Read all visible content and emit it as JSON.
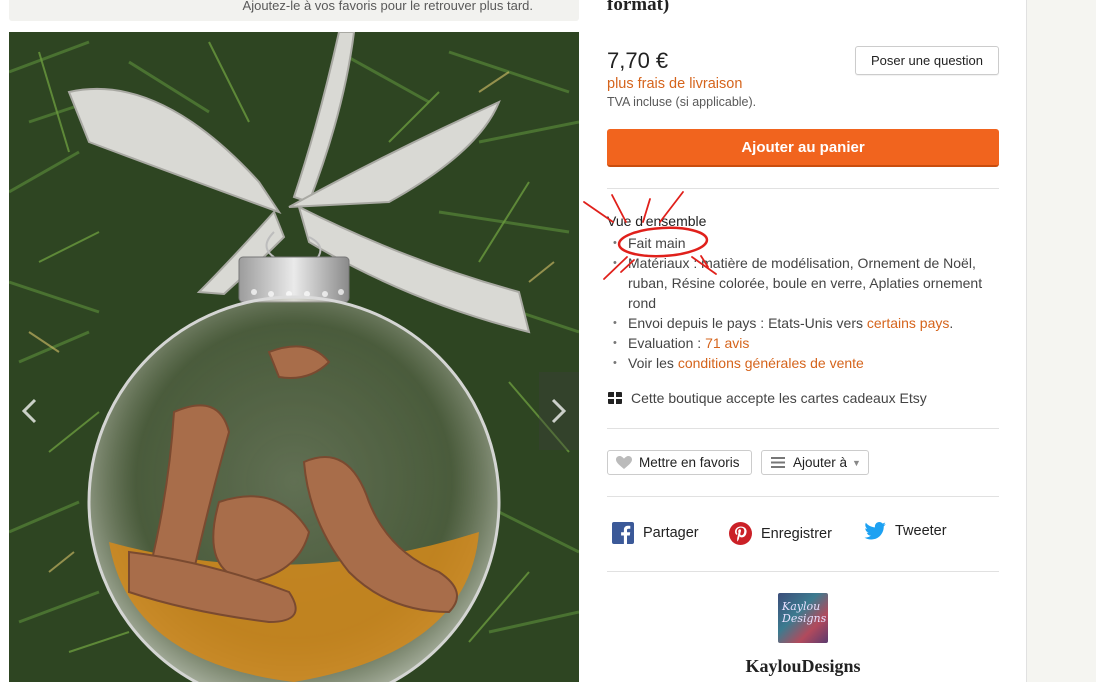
{
  "favorites_banner": {
    "text": "Ajoutez-le à vos favoris pour le retrouver plus tard."
  },
  "product": {
    "title_fragment": "format)",
    "price": "7,70 €",
    "shipping": "plus frais de livraison",
    "tva": "TVA incluse (si applicable).",
    "ask_question": "Poser une question",
    "add_to_cart": "Ajouter au panier"
  },
  "overview": {
    "title": "Vue d'ensemble",
    "handmade": "Fait main",
    "materials": "Matériaux : matière de modélisation, Ornement de Noël, ruban, Résine colorée, boule en verre, Aplaties ornement rond",
    "ships_from_prefix": "Envoi depuis le pays : Etats-Unis vers ",
    "ships_from_link": "certains pays",
    "ships_from_suffix": ".",
    "rating_prefix": "Evaluation : ",
    "rating_link": "71 avis",
    "terms_prefix": "Voir les ",
    "terms_link": "conditions générales de vente"
  },
  "giftcard": {
    "text": "Cette boutique accepte les cartes cadeaux Etsy",
    "icon": "gift-card-icon"
  },
  "actions": {
    "favorite": "Mettre en favoris",
    "add_to": "Ajouter à"
  },
  "share": {
    "facebook": "Partager",
    "pinterest": "Enregistrer",
    "twitter": "Tweeter"
  },
  "shop": {
    "avatar_text": "Kaylou Designs",
    "name": "KaylouDesigns"
  },
  "colors": {
    "accent": "#f1641e",
    "link": "#d5641c",
    "annotation": "#e0201b",
    "facebook": "#3b5998",
    "pinterest": "#cb2027",
    "twitter": "#1da1f2"
  }
}
